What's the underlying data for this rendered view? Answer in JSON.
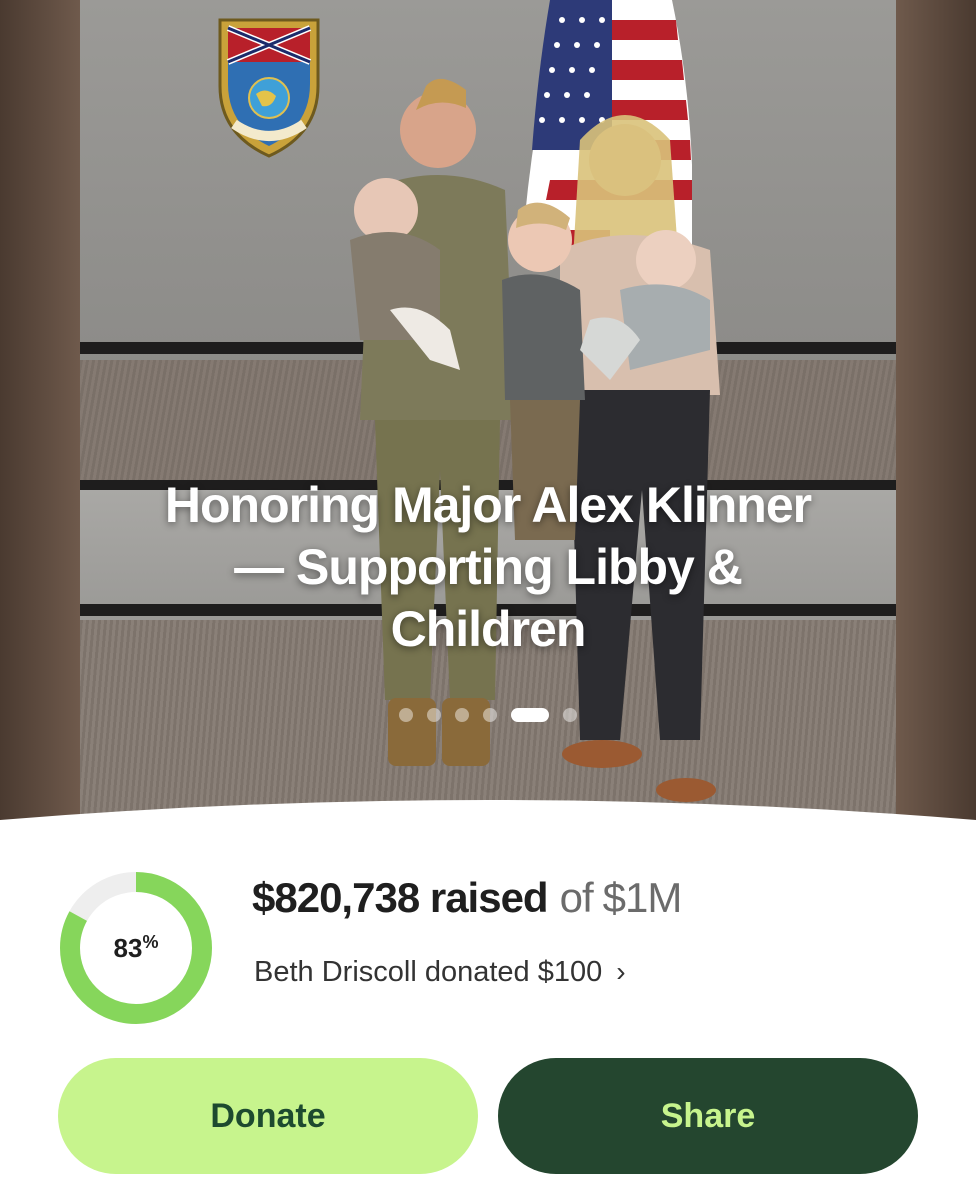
{
  "hero": {
    "title": "Honoring Major Alex Klinner — Supporting Libby & Children",
    "carousel": {
      "total": 6,
      "active_index": 4
    }
  },
  "progress": {
    "percent": 83,
    "percent_number": "83",
    "percent_symbol": "%",
    "ring_color": "#86d65b",
    "track_color": "#eeeeee"
  },
  "fundraiser": {
    "raised_amount": "$820,738 raised",
    "of_text": "of",
    "goal": "$1M",
    "recent_donation": "Beth Driscoll donated $100"
  },
  "buttons": {
    "donate": "Donate",
    "share": "Share"
  },
  "colors": {
    "donate_bg": "#c7f48d",
    "share_bg": "#24462f",
    "share_text": "#c7f48d"
  },
  "icons": {
    "chevron": "chevron-right-icon"
  }
}
